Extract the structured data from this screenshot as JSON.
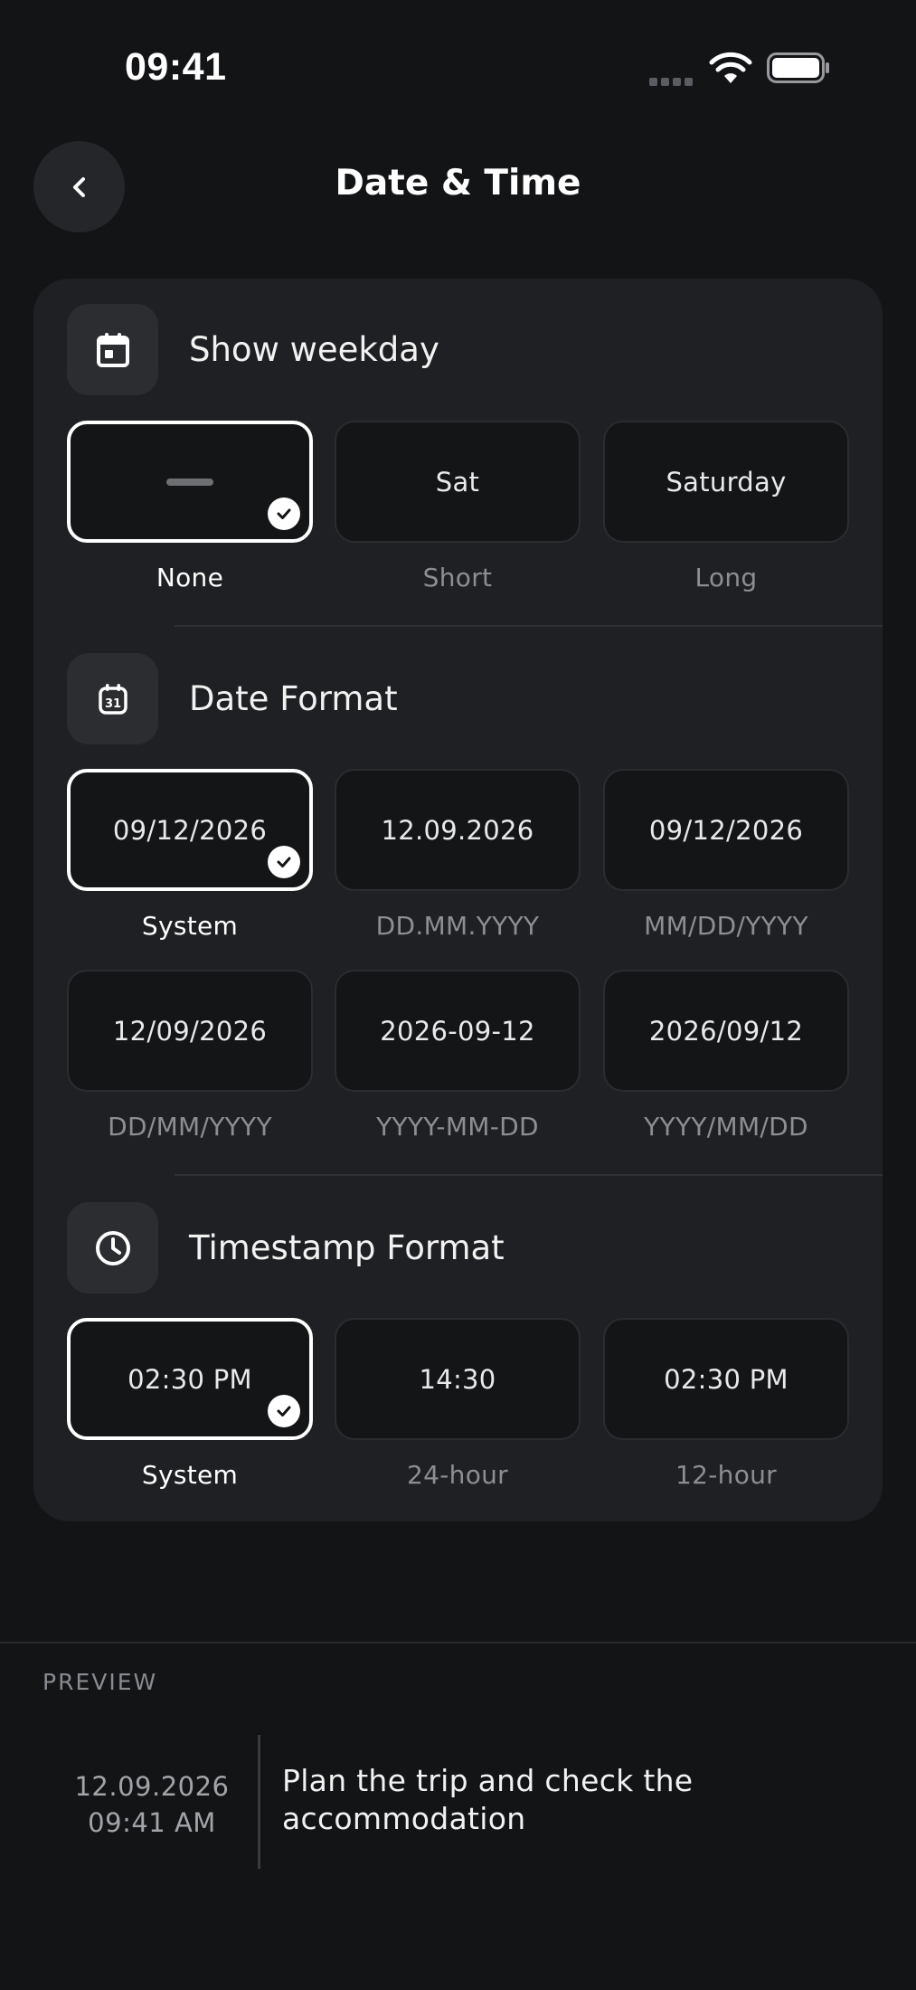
{
  "status_bar": {
    "time": "09:41"
  },
  "header": {
    "title": "Date & Time"
  },
  "sections": {
    "weekday": {
      "title": "Show weekday",
      "options": [
        {
          "value": "",
          "label": "None",
          "selected": true
        },
        {
          "value": "Sat",
          "label": "Short",
          "selected": false
        },
        {
          "value": "Saturday",
          "label": "Long",
          "selected": false
        }
      ]
    },
    "date_format": {
      "title": "Date Format",
      "options": [
        {
          "value": "09/12/2026",
          "label": "System",
          "selected": true
        },
        {
          "value": "12.09.2026",
          "label": "DD.MM.YYYY",
          "selected": false
        },
        {
          "value": "09/12/2026",
          "label": "MM/DD/YYYY",
          "selected": false
        },
        {
          "value": "12/09/2026",
          "label": "DD/MM/YYYY",
          "selected": false
        },
        {
          "value": "2026-09-12",
          "label": "YYYY-MM-DD",
          "selected": false
        },
        {
          "value": "2026/09/12",
          "label": "YYYY/MM/DD",
          "selected": false
        }
      ]
    },
    "timestamp_format": {
      "title": "Timestamp Format",
      "options": [
        {
          "value": "02:30 PM",
          "label": "System",
          "selected": true
        },
        {
          "value": "14:30",
          "label": "24-hour",
          "selected": false
        },
        {
          "value": "02:30 PM",
          "label": "12-hour",
          "selected": false
        }
      ]
    }
  },
  "preview": {
    "heading": "PREVIEW",
    "date": "12.09.2026",
    "time": "09:41 AM",
    "text": "Plan the trip and check the accommodation"
  },
  "colors": {
    "background": "#131416",
    "card": "#1f2023",
    "selected_border": "#ffffff",
    "muted_text": "#8d8e93"
  },
  "icons": {
    "back": "chevron-left-icon",
    "weekday": "calendar-icon",
    "date_format": "calendar-31-icon",
    "timestamp_format": "clock-icon",
    "selected": "checkmark-icon"
  }
}
